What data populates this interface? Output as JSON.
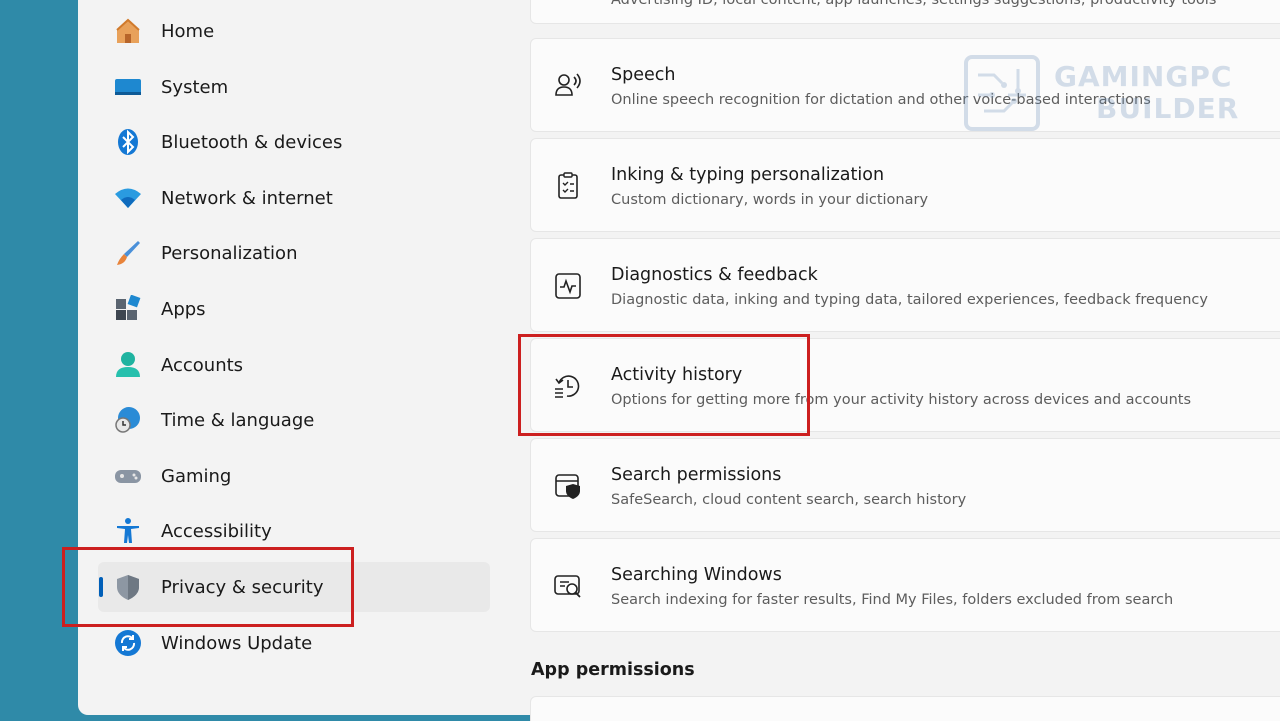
{
  "sidebar": {
    "items": [
      {
        "label": "Home",
        "icon": "home-icon"
      },
      {
        "label": "System",
        "icon": "system-icon"
      },
      {
        "label": "Bluetooth & devices",
        "icon": "bluetooth-icon"
      },
      {
        "label": "Network & internet",
        "icon": "wifi-icon"
      },
      {
        "label": "Personalization",
        "icon": "brush-icon"
      },
      {
        "label": "Apps",
        "icon": "apps-icon"
      },
      {
        "label": "Accounts",
        "icon": "account-icon"
      },
      {
        "label": "Time & language",
        "icon": "globe-clock-icon"
      },
      {
        "label": "Gaming",
        "icon": "gamepad-icon"
      },
      {
        "label": "Accessibility",
        "icon": "accessibility-icon"
      },
      {
        "label": "Privacy & security",
        "icon": "shield-icon",
        "active": true
      },
      {
        "label": "Windows Update",
        "icon": "update-icon"
      }
    ]
  },
  "main": {
    "top_partial_subtitle": "Advertising ID, local content, app launches, settings suggestions, productivity tools",
    "cards": [
      {
        "title": "Speech",
        "subtitle": "Online speech recognition for dictation and other voice-based interactions",
        "icon": "speech-icon"
      },
      {
        "title": "Inking & typing personalization",
        "subtitle": "Custom dictionary, words in your dictionary",
        "icon": "clipboard-icon"
      },
      {
        "title": "Diagnostics & feedback",
        "subtitle": "Diagnostic data, inking and typing data, tailored experiences, feedback frequency",
        "icon": "diagnostics-icon"
      },
      {
        "title": "Activity history",
        "subtitle": "Options for getting more from your activity history across devices and accounts",
        "icon": "history-icon"
      },
      {
        "title": "Search permissions",
        "subtitle": "SafeSearch, cloud content search, search history",
        "icon": "search-shield-icon"
      },
      {
        "title": "Searching Windows",
        "subtitle": "Search indexing for faster results, Find My Files, folders excluded from search",
        "icon": "search-windows-icon"
      }
    ],
    "section_heading": "App permissions"
  },
  "watermark": {
    "line1": "GAMINGPC",
    "line2": "BUILDER"
  },
  "colors": {
    "accent": "#005fb8",
    "highlight": "#cc1f1f",
    "desktop": "#2f8aa8"
  }
}
